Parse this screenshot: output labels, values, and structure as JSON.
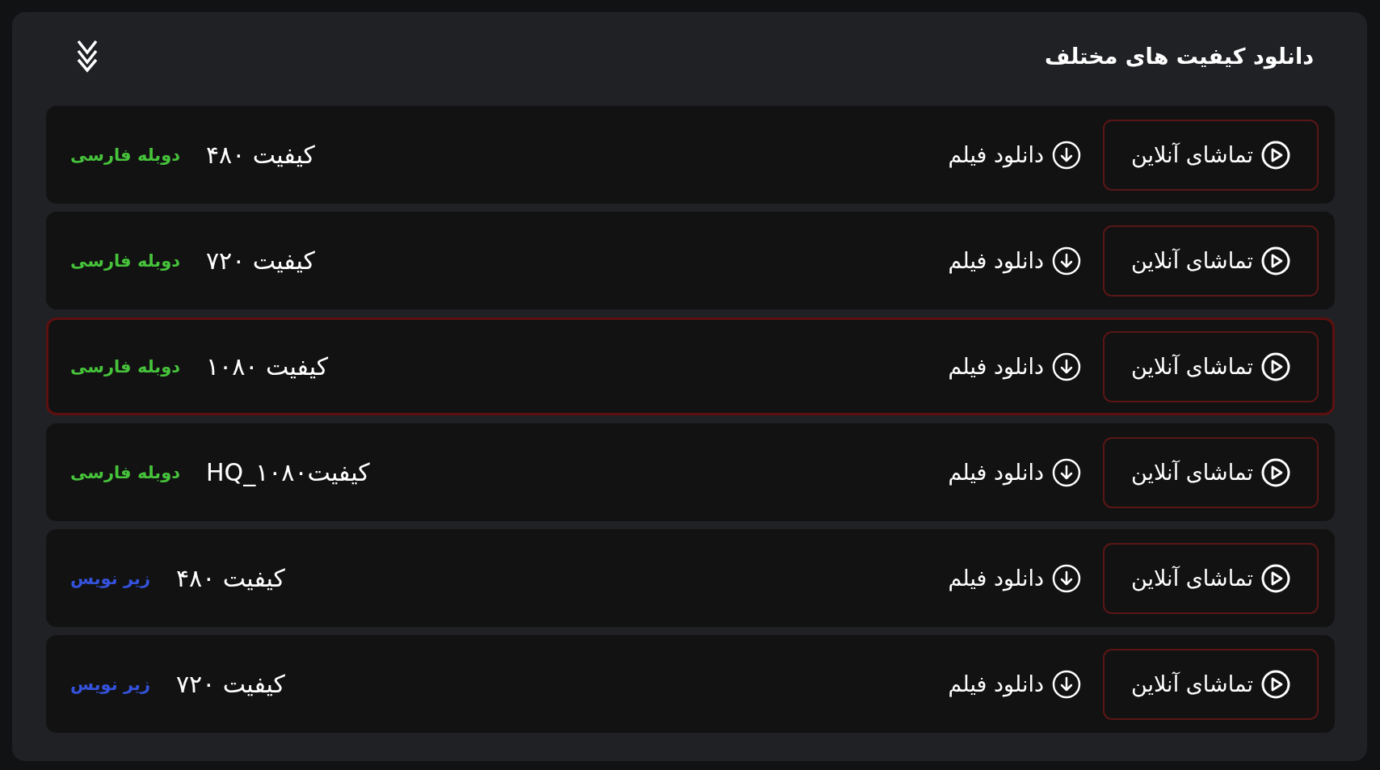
{
  "section": {
    "title": "دانلود کیفیت های مختلف"
  },
  "qualities": [
    {
      "quality": "کیفیت ۴۸۰",
      "tag": {
        "label": "دوبله فارسی",
        "color": "#46c23b"
      },
      "watch_button": "تماشای آنلاین",
      "download_link": "دانلود فیلم",
      "selected": false
    },
    {
      "quality": "کیفیت ۷۲۰",
      "tag": {
        "label": "دوبله فارسی",
        "color": "#46c23b"
      },
      "watch_button": "تماشای آنلاین",
      "download_link": "دانلود فیلم",
      "selected": false
    },
    {
      "quality": "کیفیت ۱۰۸۰",
      "tag": {
        "label": "دوبله فارسی",
        "color": "#46c23b"
      },
      "watch_button": "تماشای آنلاین",
      "download_link": "دانلود فیلم",
      "selected": true
    },
    {
      "quality": "کیفیت۱۰۸۰_HQ",
      "tag": {
        "label": "دوبله فارسی",
        "color": "#46c23b"
      },
      "watch_button": "تماشای آنلاین",
      "download_link": "دانلود فیلم",
      "selected": false
    },
    {
      "quality": "کیفیت ۴۸۰",
      "tag": {
        "label": "زیر نویس",
        "color": "#3452db"
      },
      "watch_button": "تماشای آنلاین",
      "download_link": "دانلود فیلم",
      "selected": false
    },
    {
      "quality": "کیفیت ۷۲۰",
      "tag": {
        "label": "زیر نویس",
        "color": "#3452db"
      },
      "watch_button": "تماشای آنلاین",
      "download_link": "دانلود فیلم",
      "selected": false
    }
  ]
}
